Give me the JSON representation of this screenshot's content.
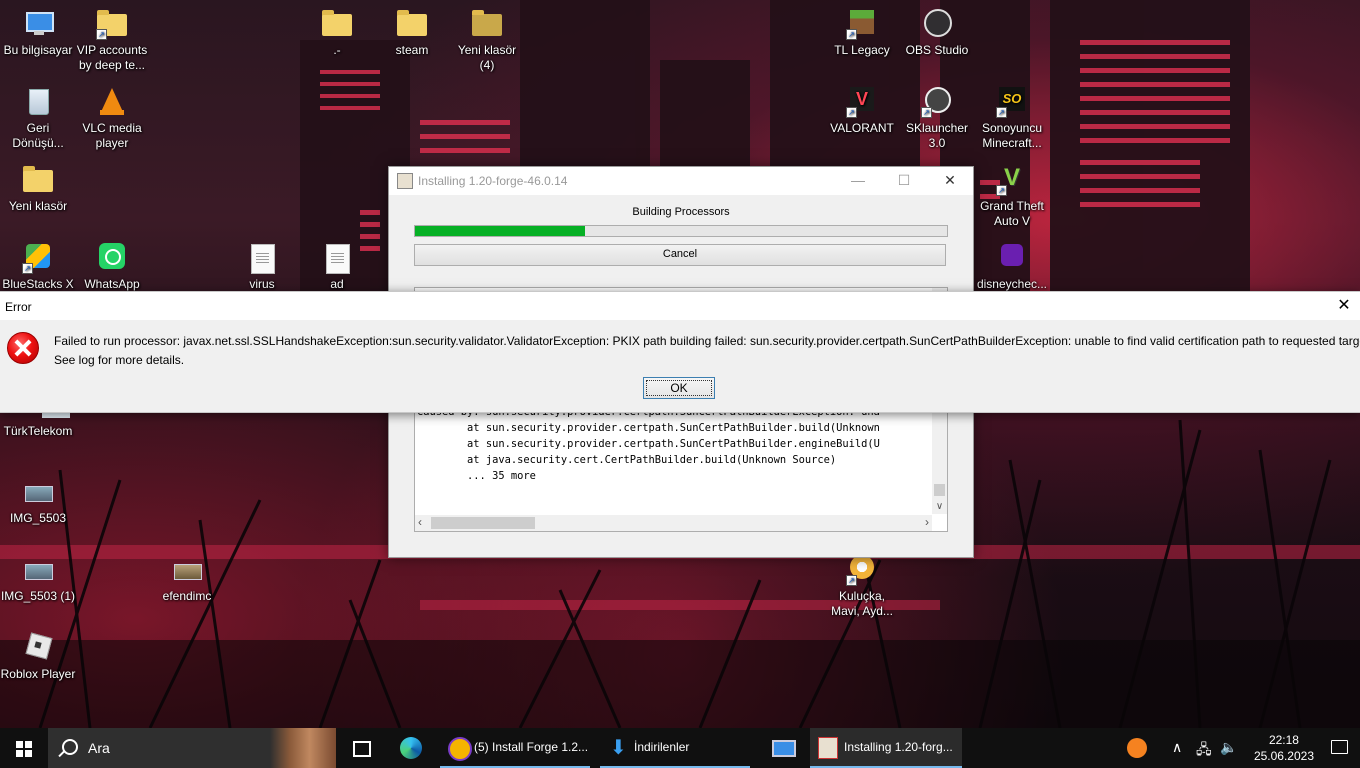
{
  "desktop": {
    "icons": [
      {
        "label": "Bu bilgisayar",
        "kind": "pc-icon"
      },
      {
        "label": "VIP accounts by deep te...",
        "kind": "folder-icon"
      },
      {
        "label": ".-",
        "kind": "folder-icon"
      },
      {
        "label": "steam",
        "kind": "folder-icon"
      },
      {
        "label": "Yeni klasör (4)",
        "kind": "folder-icon"
      },
      {
        "label": "TL Legacy",
        "kind": "minecraft-icon"
      },
      {
        "label": "OBS Studio",
        "kind": "obs-icon"
      },
      {
        "label": "Geri Dönüşü...",
        "kind": "recycle-bin-icon"
      },
      {
        "label": "VLC media player",
        "kind": "vlc-icon"
      },
      {
        "label": "VALORANT",
        "kind": "valorant-icon"
      },
      {
        "label": "SKlauncher 3.0",
        "kind": "sklauncher-icon"
      },
      {
        "label": "Sonoyuncu Minecraft...",
        "kind": "sonoyuncu-icon"
      },
      {
        "label": "Yeni klasör",
        "kind": "folder-icon"
      },
      {
        "label": "Grand Theft Auto V",
        "kind": "gta-icon"
      },
      {
        "label": "BlueStacks X",
        "kind": "bluestacks-icon"
      },
      {
        "label": "WhatsApp",
        "kind": "whatsapp-icon"
      },
      {
        "label": "virus",
        "kind": "text-file-icon"
      },
      {
        "label": "ad",
        "kind": "text-file-icon"
      },
      {
        "label": "disneychec...",
        "kind": "disney-icon"
      },
      {
        "label": "TürkTelekom",
        "kind": "turktelekom-icon"
      },
      {
        "label": "IMG_5503",
        "kind": "image-icon"
      },
      {
        "label": "IMG_5503 (1)",
        "kind": "image-icon"
      },
      {
        "label": "efendimc",
        "kind": "image-icon"
      },
      {
        "label": "Kuluçka, Mavi, Ayd...",
        "kind": "kulucka-icon"
      },
      {
        "label": "Roblox Player",
        "kind": "roblox-icon"
      }
    ]
  },
  "forge_window": {
    "title": "Installing 1.20-forge-46.0.14",
    "status": "Building Processors",
    "progress": 0.32,
    "cancel_label": "Cancel",
    "log_lines": [
      "Caused by: sun.security.provider.certpath.SunCertPathBuilderException: una",
      "        at sun.security.provider.certpath.SunCertPathBuilder.build(Unknown",
      "        at sun.security.provider.certpath.SunCertPathBuilder.engineBuild(U",
      "        at java.security.cert.CertPathBuilder.build(Unknown Source)",
      "        ... 35 more"
    ],
    "minimize_symbol": "—",
    "maximize_symbol": "☐",
    "close_symbol": "✕"
  },
  "error_dialog": {
    "title": "Error",
    "message_line1": "Failed to run processor: javax.net.ssl.SSLHandshakeException:sun.security.validator.ValidatorException: PKIX path building failed: sun.security.provider.certpath.SunCertPathBuilderException: unable to find valid certification path to requested target",
    "message_line2": "See log for more details.",
    "ok_label": "OK",
    "close_symbol": "✕"
  },
  "taskbar": {
    "search_placeholder": "Ara",
    "items": [
      {
        "label": "(5) Install Forge 1.2...",
        "icon": "browser-icon"
      },
      {
        "label": "İndirilenler",
        "icon": "download-folder-icon"
      },
      {
        "label": "Installing 1.20-forg...",
        "icon": "java-icon"
      }
    ],
    "time": "22:18",
    "date": "25.06.2023",
    "accent_color": "#76b9ed"
  }
}
